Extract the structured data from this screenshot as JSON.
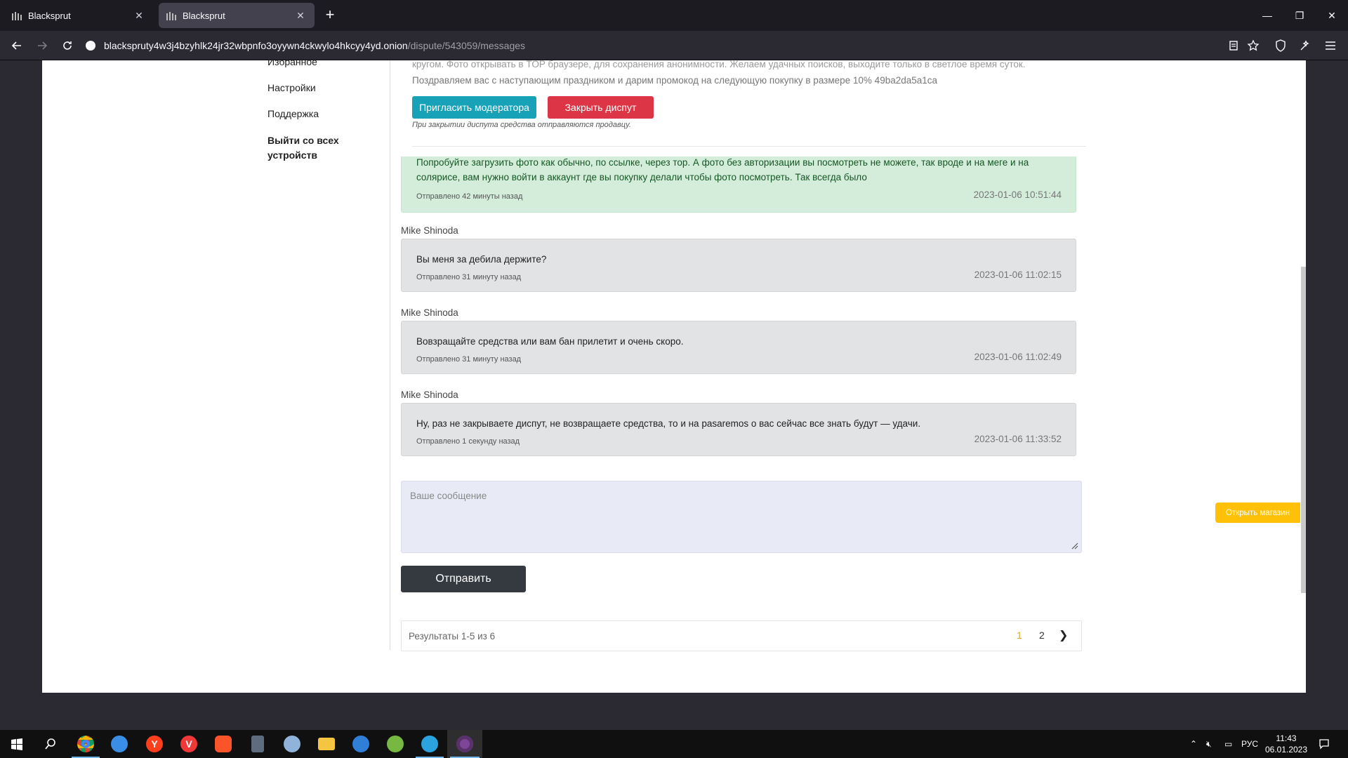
{
  "browser": {
    "tabs": [
      {
        "title": "Blacksprut",
        "active": false
      },
      {
        "title": "Blacksprut",
        "active": true
      }
    ],
    "url_host": "blacksprutу4w3j4bzyhlk24jr32wbpnfo3oyywn4ckwylo4hkcyy4yd.onion",
    "url_path": "/dispute/543059/messages"
  },
  "sidebar": {
    "items": [
      {
        "label": "Избранное"
      },
      {
        "label": "Настройки"
      },
      {
        "label": "Поддержка"
      },
      {
        "label": "Выйти со всех устройств"
      }
    ]
  },
  "dispute": {
    "notice_cut": "кругом. Фото открывать в TOP браузере, для сохранения анонимности. Желаем удачных поисков, выходите только в светлое время суток.",
    "notice_promo": "Поздравляем вас с наступающим праздником и дарим промокод на следующую покупку в размере 10% 49ba2da5a1ca",
    "invite_moderator": "Пригласить модератора",
    "close_dispute": "Закрыть диспут",
    "close_note": "При закрытии диспута средства отправляются продавцу."
  },
  "messages": [
    {
      "sender": "",
      "text": "Попробуйте загрузить фото как обычно, по ссылке, через тор. А фото без авторизации вы посмотреть не можете, так вроде и на меге и на солярисе, вам нужно войти в аккаунт где вы покупку делали чтобы фото посмотреть. Так всегда было",
      "sent": "Отправлено 42 минуты назад",
      "timestamp": "2023-01-06 10:51:44"
    },
    {
      "sender": "Mike Shinoda",
      "text": "Вы меня за дебила держите?",
      "sent": "Отправлено 31 минуту назад",
      "timestamp": "2023-01-06 11:02:15"
    },
    {
      "sender": "Mike Shinoda",
      "text": "Вовзращайте средства или вам бан прилетит и очень скоро.",
      "sent": "Отправлено 31 минуту назад",
      "timestamp": "2023-01-06 11:02:49"
    },
    {
      "sender": "Mike Shinoda",
      "text": "Ну, раз не закрываете диспут, не возвращаете средства, то и на pasaremos о вас сейчас все знать будут — удачи.",
      "sent": "Отправлено 1 секунду назад",
      "timestamp": "2023-01-06 11:33:52"
    }
  ],
  "composer": {
    "placeholder": "Ваше сообщение",
    "send_label": "Отправить"
  },
  "pagination": {
    "results": "Результаты 1-5 из 6",
    "pages": [
      "1",
      "2"
    ],
    "current": "1",
    "next": "❯"
  },
  "shop_button": "Открыть магазин",
  "taskbar": {
    "lang": "РУС",
    "time": "11:43",
    "date": "06.01.2023"
  }
}
